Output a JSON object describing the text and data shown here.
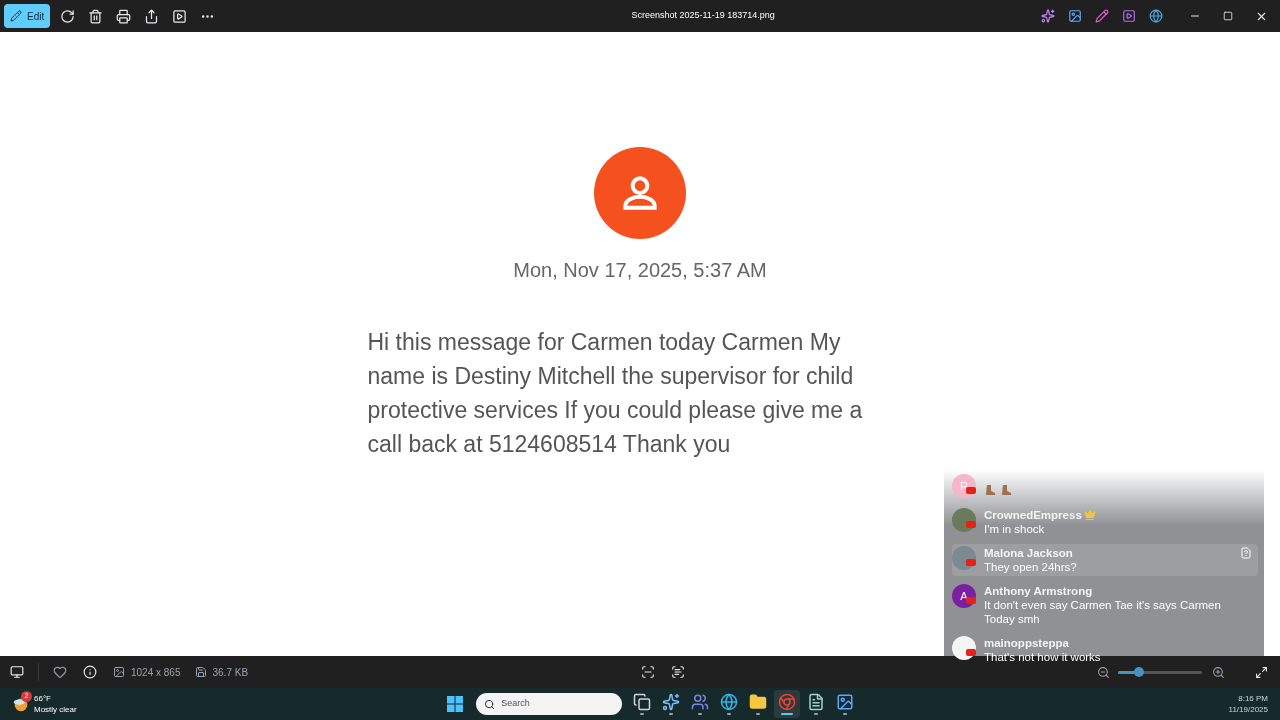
{
  "titlebar": {
    "edit_label": "Edit",
    "title": "Screenshot 2025-11-19 183714.png"
  },
  "image": {
    "date": "Mon, Nov 17, 2025, 5:37 AM",
    "message": "Hi this message for Carmen today Carmen My name is Destiny Mitchell the supervisor for child protective services If you could please give me a call back at 5124608514 Thank you"
  },
  "bottom_bar": {
    "favorited": false,
    "dimensions": "1024 x 865",
    "file_size": "36.7 KB",
    "zoom": {
      "level": 0.25
    }
  },
  "chat": [
    {
      "kind": "emoji",
      "avatar_letter": "R",
      "color": "#f4b6c8"
    },
    {
      "kind": "crown",
      "color": "#6b7a5a",
      "name": "CrownedEmpress",
      "text": "I'm in shock",
      "highlighted": false
    },
    {
      "kind": "plain",
      "color": "#7a8a90",
      "name": "Malona Jackson",
      "text": "They open 24hrs?",
      "highlighted": true
    },
    {
      "kind": "plain",
      "avatar_letter": "A",
      "color": "#7b1fa2",
      "name": "Anthony Armstrong",
      "text": "It don't even say Carmen Tae it's says Carmen Today smh",
      "highlighted": false
    },
    {
      "kind": "plain",
      "color": "#f5f5f5",
      "name": "mainoppsteppa",
      "text": "That's not how it works",
      "highlighted": false
    }
  ],
  "taskbar": {
    "weather_badge": "2",
    "temperature": "66°F",
    "condition": "Mostly clear",
    "search_placeholder": "Search",
    "apps": [
      {
        "kind": "taskview",
        "selected": false
      },
      {
        "kind": "copilot",
        "selected": false
      },
      {
        "kind": "teams",
        "selected": false
      },
      {
        "kind": "edge",
        "selected": false
      },
      {
        "kind": "files",
        "selected": false
      },
      {
        "kind": "chrome",
        "selected": true
      },
      {
        "kind": "notepad",
        "selected": false
      },
      {
        "kind": "photos",
        "selected": false
      }
    ],
    "time": "8:16 PM",
    "date": "11/19/2025"
  }
}
